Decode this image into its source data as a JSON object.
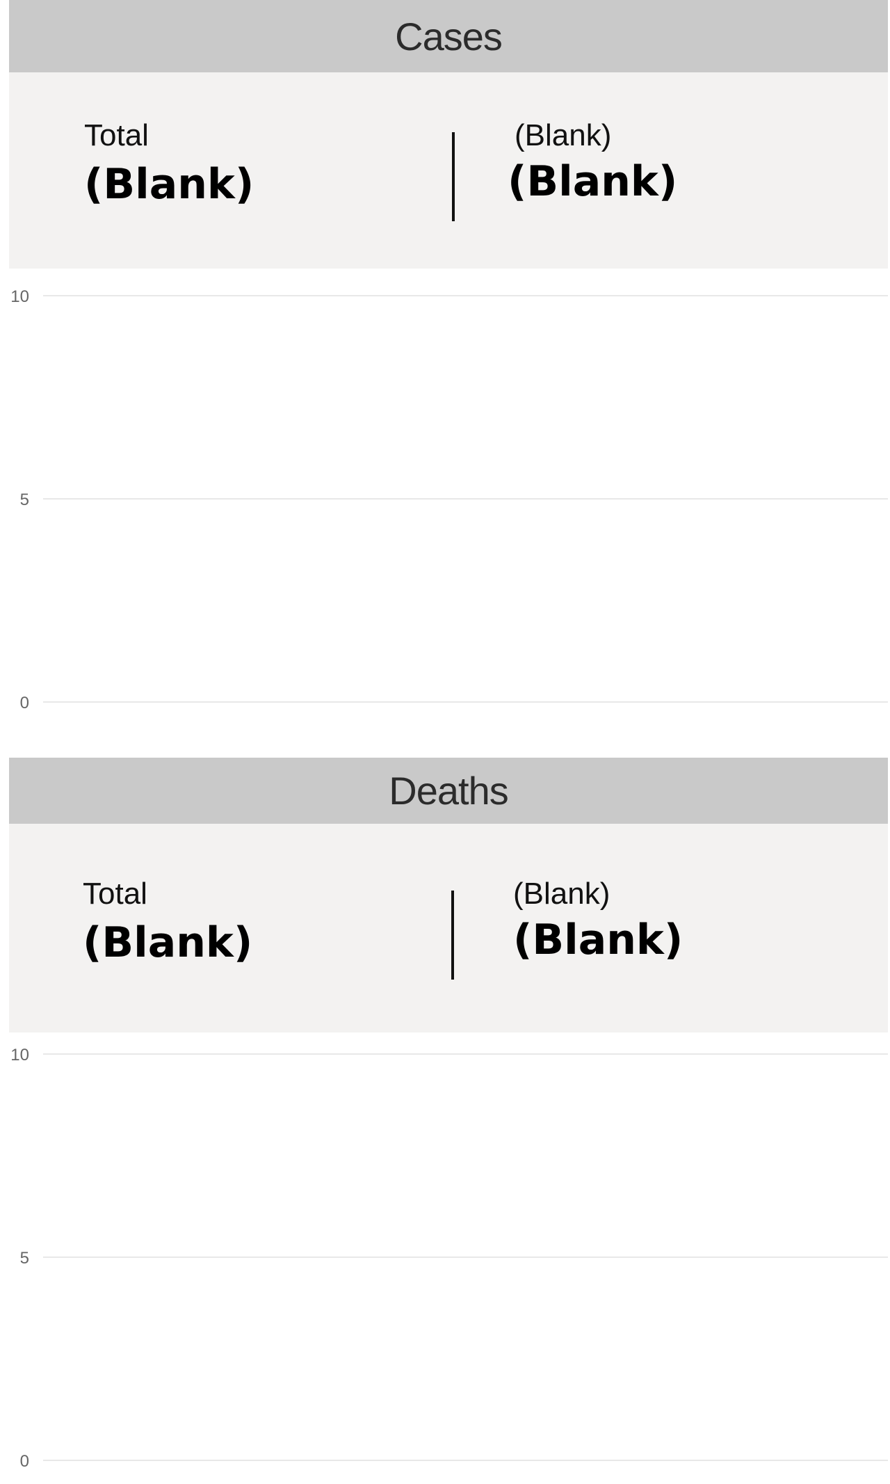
{
  "sections": [
    {
      "title": "Cases",
      "kpis": [
        {
          "label": "Total",
          "value": "(Blank)"
        },
        {
          "label": "(Blank)",
          "value": "(Blank)"
        }
      ]
    },
    {
      "title": "Deaths",
      "kpis": [
        {
          "label": "Total",
          "value": "(Blank)"
        },
        {
          "label": "(Blank)",
          "value": "(Blank)"
        }
      ]
    }
  ],
  "colors": {
    "header_bg": "#c9c9c9",
    "card_bg": "#f3f2f1",
    "gridline": "#e8e8e8",
    "tick_text": "#666666"
  },
  "chart_data": [
    {
      "type": "line",
      "title": "",
      "xlabel": "",
      "ylabel": "",
      "ylim": [
        0,
        10
      ],
      "yticks": [
        "10",
        "5",
        "0"
      ],
      "series": [],
      "grid": true
    },
    {
      "type": "line",
      "title": "",
      "xlabel": "",
      "ylabel": "",
      "ylim": [
        0,
        10
      ],
      "yticks": [
        "10",
        "5",
        "0"
      ],
      "series": [],
      "grid": true
    }
  ]
}
